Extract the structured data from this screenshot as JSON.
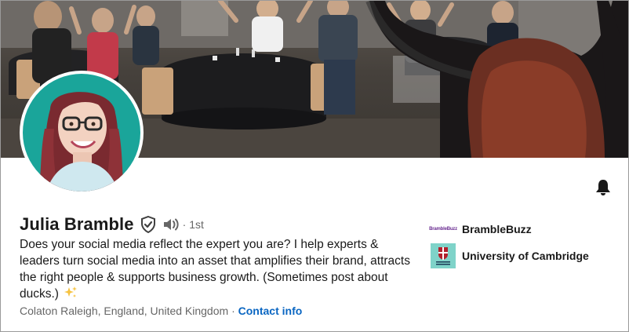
{
  "profile": {
    "name": "Julia Bramble",
    "degree_separator": "·",
    "degree": "1st",
    "headline_text": "Does your social media reflect the expert you are? I help experts & leaders turn social media into an asset that amplifies their brand, attracts the right people & supports business growth. (Sometimes post about ducks.)",
    "location": "Colaton Raleigh, England, United Kingdom",
    "location_separator": "·",
    "contact_label": "Contact info"
  },
  "organizations": [
    {
      "name": "BrambleBuzz",
      "logo_text": "BrambleBuzz"
    },
    {
      "name": "University of Cambridge",
      "logo_text": "UNIVERSITY OF CAMBRIDGE"
    }
  ],
  "icons": {
    "verified": "shield-check-icon",
    "pronunciation": "speaker-icon",
    "notifications": "bell-icon",
    "sparkles": "sparkles-icon"
  },
  "colors": {
    "link": "#0a66c2",
    "avatar_background": "#1aa59a",
    "secondary_text": "#666666"
  }
}
